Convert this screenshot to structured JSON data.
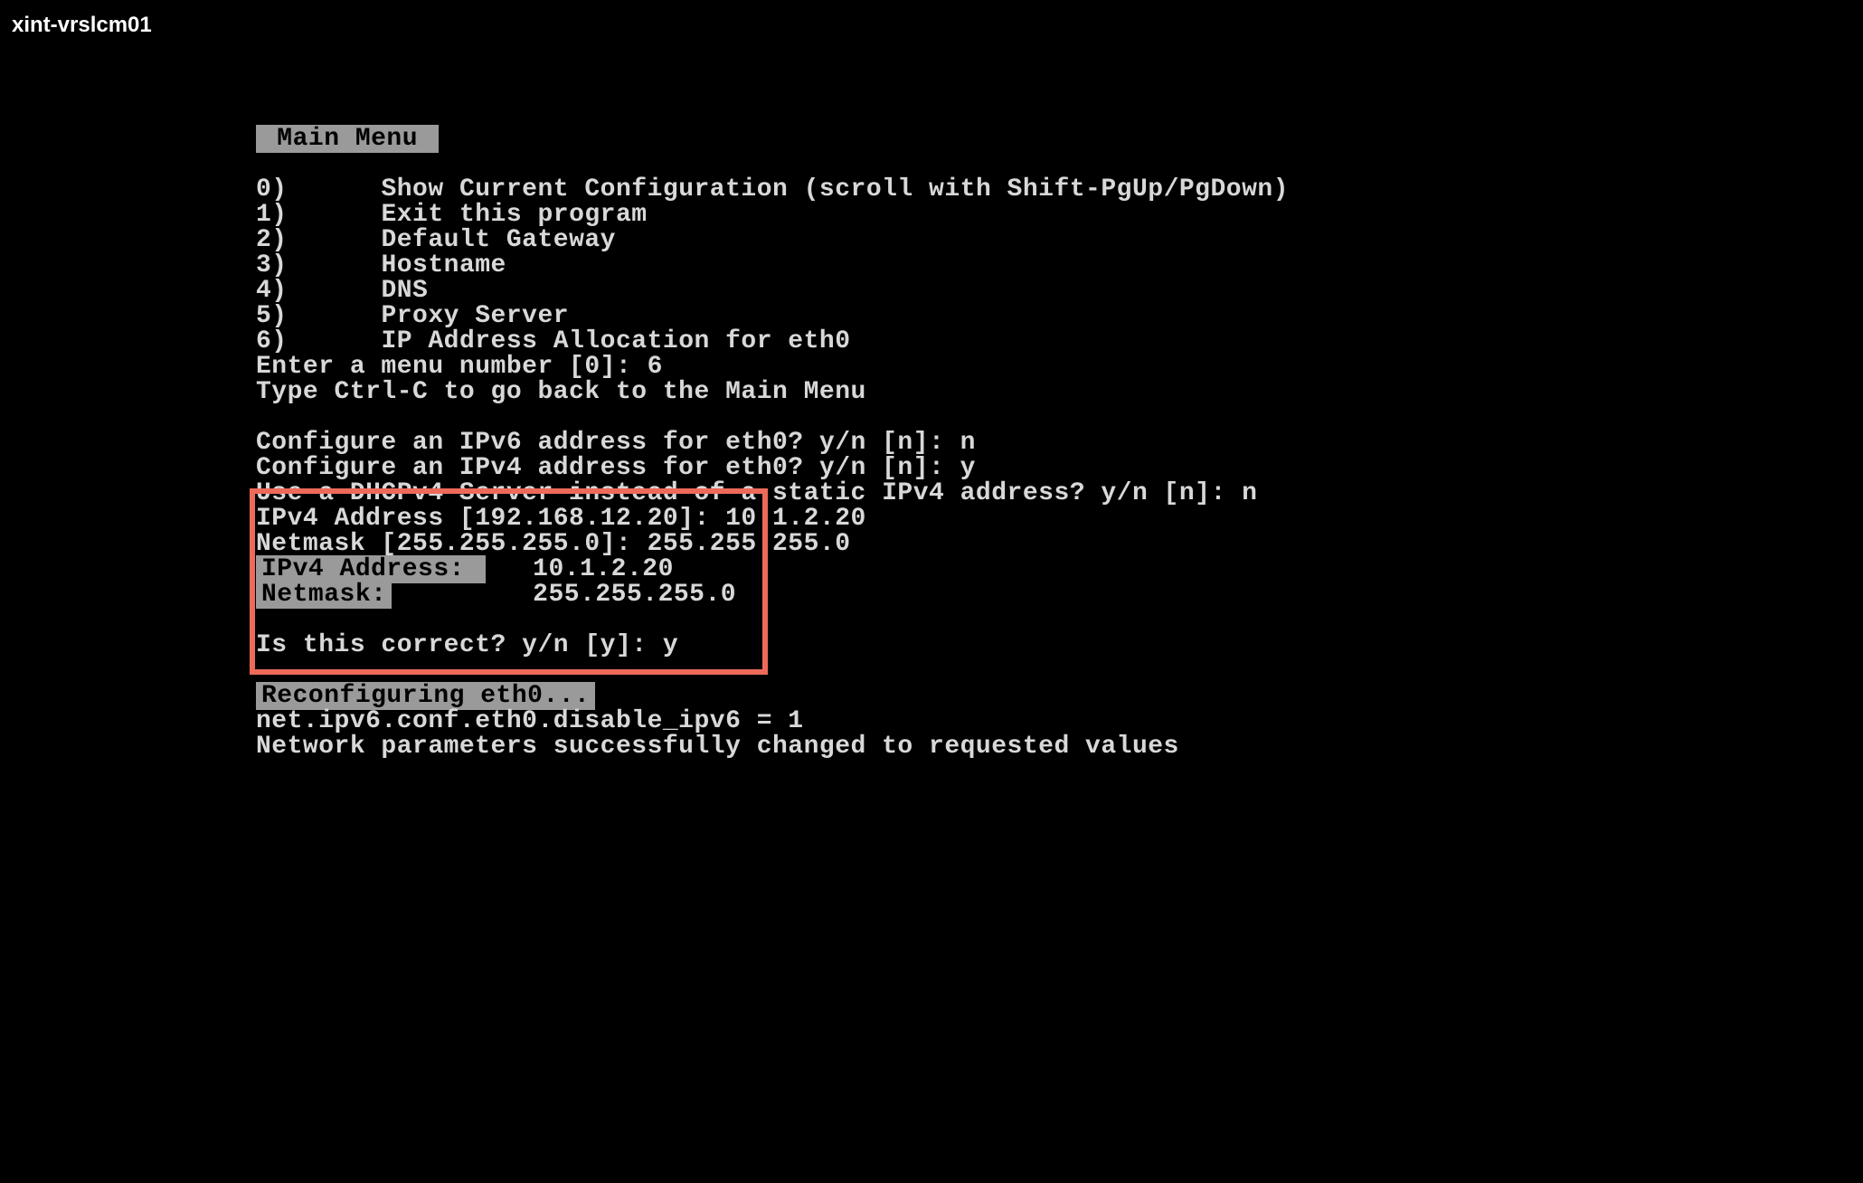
{
  "titlebar": "xint-vrslcm01",
  "menu_header": " Main Menu ",
  "menu_items": [
    {
      "num": "0)",
      "label": "Show Current Configuration (scroll with Shift-PgUp/PgDown)"
    },
    {
      "num": "1)",
      "label": "Exit this program"
    },
    {
      "num": "2)",
      "label": "Default Gateway"
    },
    {
      "num": "3)",
      "label": "Hostname"
    },
    {
      "num": "4)",
      "label": "DNS"
    },
    {
      "num": "5)",
      "label": "Proxy Server"
    },
    {
      "num": "6)",
      "label": "IP Address Allocation for eth0"
    }
  ],
  "prompts": {
    "menu_prompt": "Enter a menu number [0]: ",
    "menu_input": "6",
    "back_hint": "Type Ctrl-C to go back to the Main Menu",
    "ipv6_q": "Configure an IPv6 address for eth0? y/n [n]: ",
    "ipv6_a": "n",
    "ipv4_q": "Configure an IPv4 address for eth0? y/n [n]: ",
    "ipv4_a": "y",
    "dhcp_q": "Use a DHCPv4 Server instead of a static IPv4 address? y/n [n]: ",
    "dhcp_a": "n",
    "ipv4_addr_q": "IPv4 Address [192.168.12.20]: ",
    "ipv4_addr_a": "10.1.2.20",
    "netmask_q": "Netmask [255.255.255.0]: ",
    "netmask_a": "255.255.255.0",
    "summary_ipv4_label": "IPv4 Address: ",
    "summary_ipv4_value": "   10.1.2.20",
    "summary_netmask_label": "Netmask:",
    "summary_netmask_value": "         255.255.255.0",
    "confirm_q": "Is this correct? y/n [y]: ",
    "confirm_a": "y"
  },
  "status": {
    "reconfig": "Reconfiguring eth0...",
    "disable_ipv6": "net.ipv6.conf.eth0.disable_ipv6 = 1",
    "success": "Network parameters successfully changed to requested values"
  }
}
